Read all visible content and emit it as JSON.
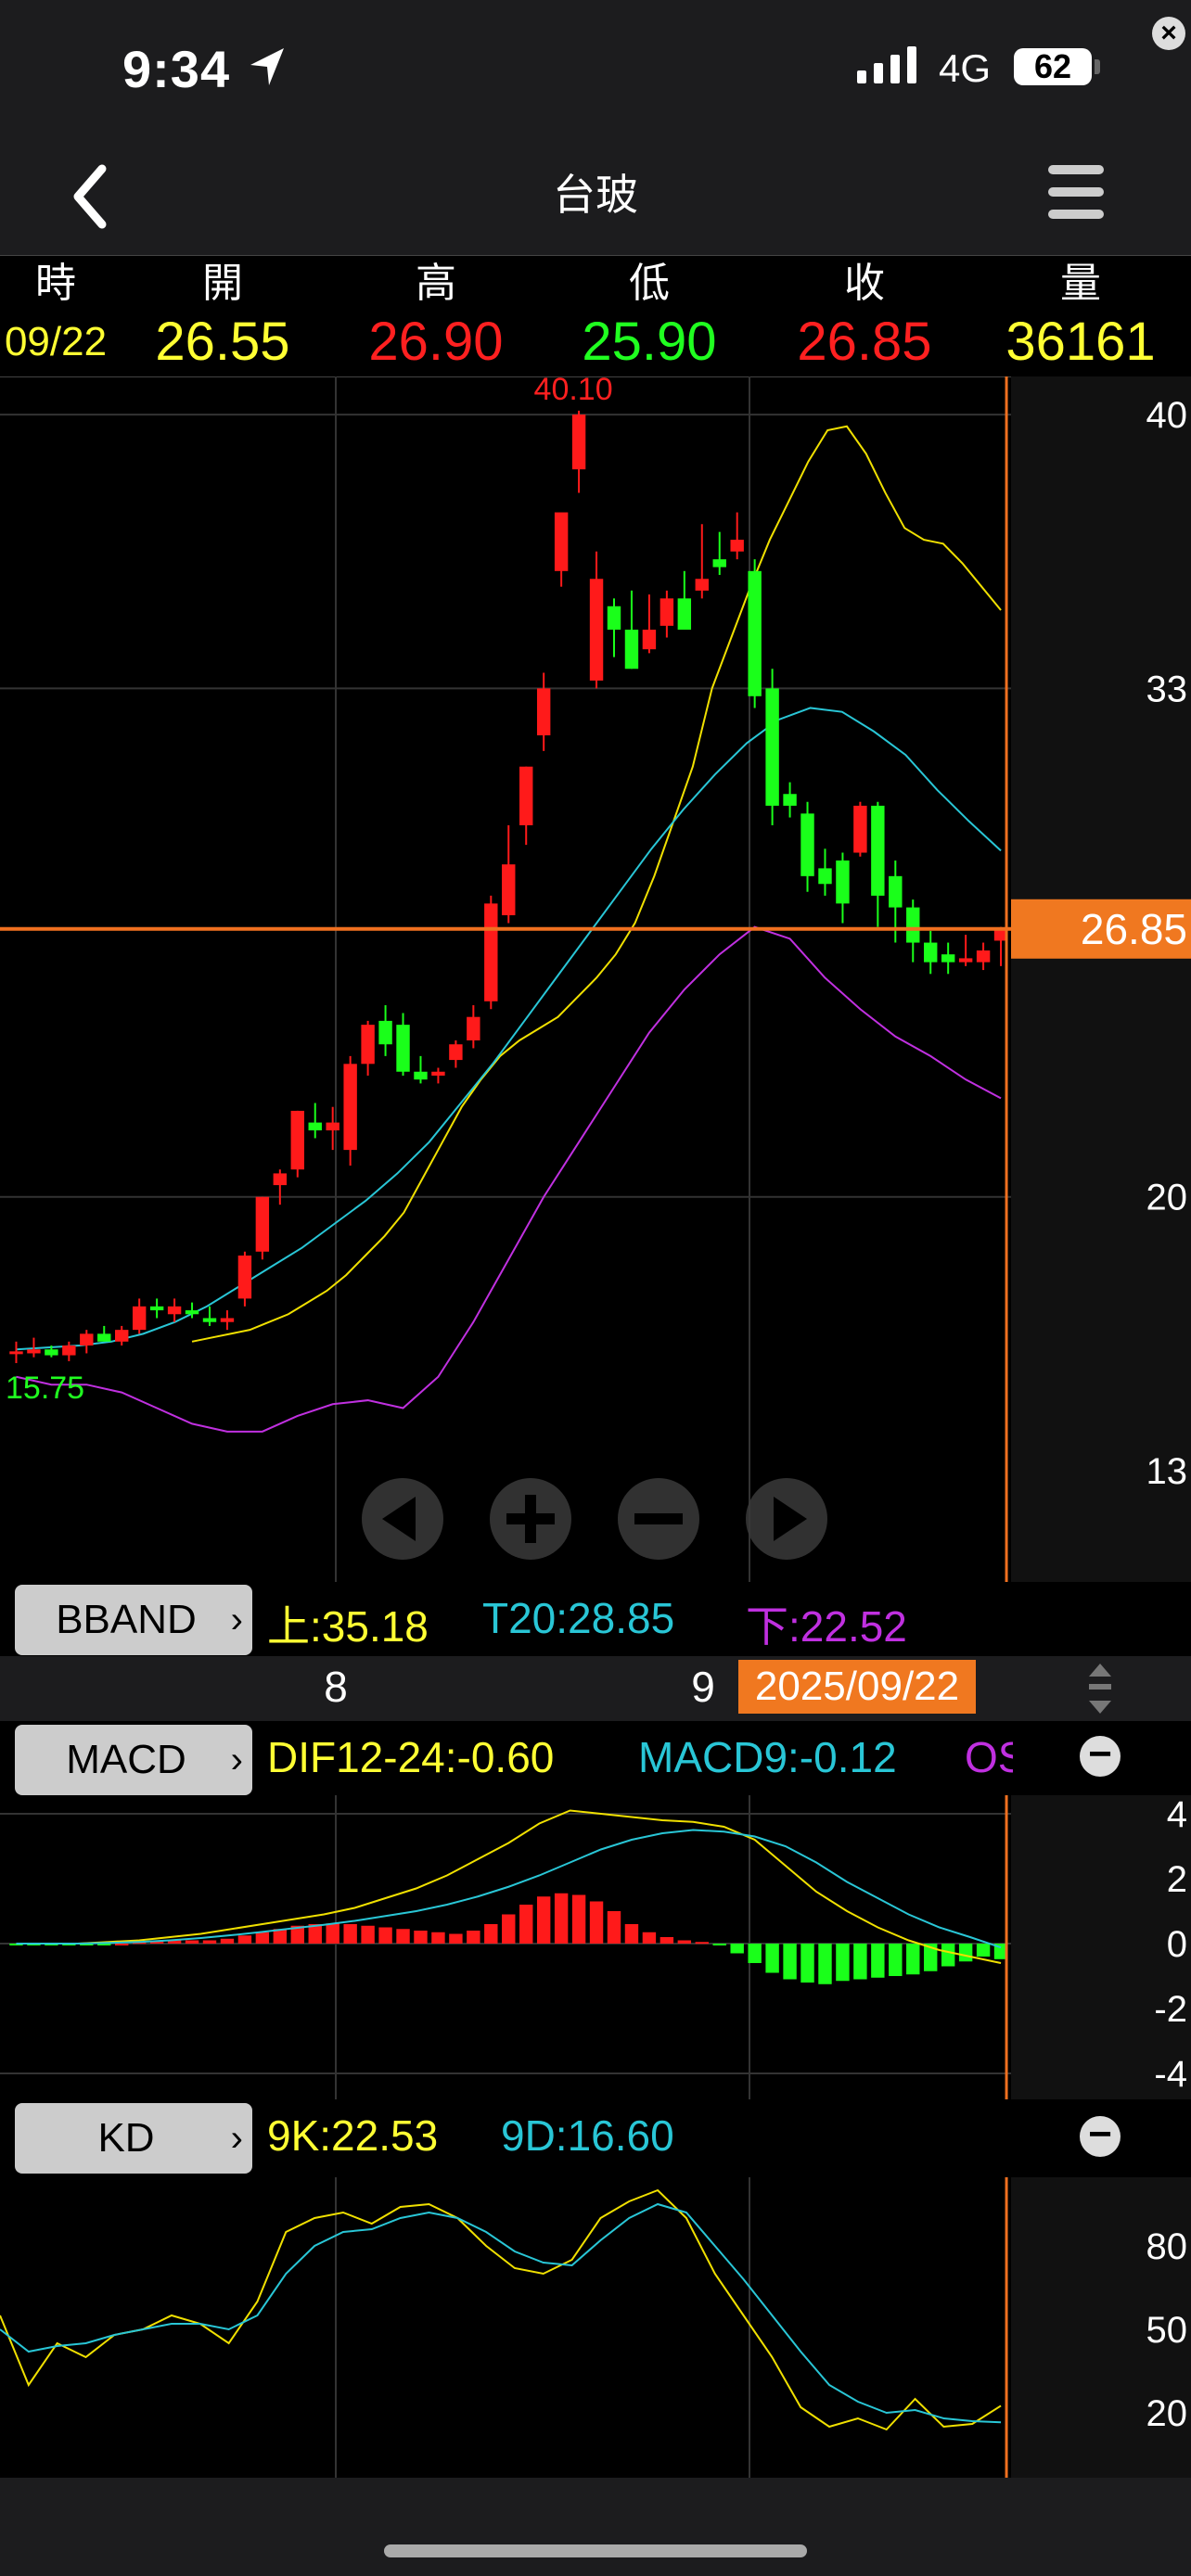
{
  "status_bar": {
    "time": "9:34",
    "network": "4G",
    "battery": "62"
  },
  "nav": {
    "title": "台玻"
  },
  "quote": {
    "headers": [
      "時",
      "開",
      "高",
      "低",
      "收",
      "量"
    ],
    "values": [
      "09/22",
      "26.55",
      "26.90",
      "25.90",
      "26.85",
      "36161"
    ],
    "colors": [
      "#ffff33",
      "#ffff33",
      "#ff2020",
      "#20ff20",
      "#ff2020",
      "#ffff33"
    ]
  },
  "main_chart": {
    "y_labels": [
      "40",
      "33",
      "20",
      "13"
    ],
    "high_label": "40.10",
    "low_label": "15.75",
    "current_price": "26.85",
    "legend": {
      "name": "BBAND",
      "upper": "上:35.18",
      "mid": "T20:28.85",
      "lower": "下:22.52"
    }
  },
  "date_axis": {
    "labels": [
      "8",
      "9"
    ],
    "selected": "2025/09/22"
  },
  "macd": {
    "name": "MACD",
    "dif": "DIF12-24:-0.60",
    "macd": "MACD9:-0.12",
    "osc": "OS",
    "y_labels": [
      "4",
      "2",
      "0",
      "-2",
      "-4"
    ]
  },
  "kd": {
    "name": "KD",
    "k": "9K:22.53",
    "d": "9D:16.60",
    "y_labels": [
      "80",
      "50",
      "20"
    ]
  },
  "colors": {
    "up": "#ff1a1a",
    "down": "#1aff1a",
    "upper_band": "#f0e000",
    "mid_band": "#29c6d6",
    "lower_band": "#c030e0",
    "cursor": "#f07020"
  },
  "chart_data": [
    {
      "type": "candlestick",
      "title": "台玻",
      "ylim": [
        13,
        40.5
      ],
      "candles_ohlc": [
        [
          16.0,
          16.3,
          15.75,
          16.05
        ],
        [
          16.0,
          16.4,
          15.9,
          16.1
        ],
        [
          16.1,
          16.2,
          15.9,
          15.95
        ],
        [
          15.95,
          16.3,
          15.8,
          16.2
        ],
        [
          16.2,
          16.6,
          16.0,
          16.5
        ],
        [
          16.5,
          16.7,
          16.3,
          16.3
        ],
        [
          16.3,
          16.7,
          16.2,
          16.6
        ],
        [
          16.6,
          17.4,
          16.5,
          17.2
        ],
        [
          17.2,
          17.4,
          16.9,
          17.1
        ],
        [
          17.0,
          17.4,
          16.8,
          17.2
        ],
        [
          17.1,
          17.3,
          16.9,
          17.0
        ],
        [
          16.9,
          17.2,
          16.7,
          16.8
        ],
        [
          16.8,
          17.1,
          16.6,
          16.9
        ],
        [
          17.4,
          18.6,
          17.2,
          18.5
        ],
        [
          18.6,
          20.0,
          18.4,
          20.0
        ],
        [
          20.3,
          20.7,
          19.8,
          20.6
        ],
        [
          20.7,
          22.2,
          20.5,
          22.2
        ],
        [
          21.9,
          22.4,
          21.5,
          21.7
        ],
        [
          21.7,
          22.3,
          21.2,
          21.9
        ],
        [
          21.2,
          23.6,
          20.8,
          23.4
        ],
        [
          23.4,
          24.5,
          23.1,
          24.4
        ],
        [
          24.5,
          24.9,
          23.6,
          23.9
        ],
        [
          24.4,
          24.7,
          23.1,
          23.2
        ],
        [
          23.2,
          23.6,
          22.9,
          23.0
        ],
        [
          23.1,
          23.3,
          22.9,
          23.2
        ],
        [
          23.5,
          24.0,
          23.3,
          23.9
        ],
        [
          24.0,
          24.9,
          23.8,
          24.6
        ],
        [
          25.0,
          27.7,
          24.8,
          27.5
        ],
        [
          27.2,
          29.5,
          27.0,
          28.5
        ],
        [
          29.5,
          31.0,
          29.0,
          31.0
        ],
        [
          31.8,
          33.4,
          31.4,
          33.0
        ],
        [
          36.0,
          37.0,
          35.6,
          37.5
        ],
        [
          38.6,
          40.1,
          38.0,
          40.0
        ],
        [
          33.2,
          36.5,
          33.0,
          35.8
        ],
        [
          35.1,
          35.3,
          33.8,
          34.5
        ],
        [
          34.5,
          35.5,
          33.5,
          33.5
        ],
        [
          34.0,
          35.4,
          33.9,
          34.5
        ],
        [
          34.6,
          35.5,
          34.3,
          35.3
        ],
        [
          35.3,
          36.0,
          34.8,
          34.5
        ],
        [
          35.5,
          37.2,
          35.3,
          35.8
        ],
        [
          36.3,
          37.0,
          35.9,
          36.1
        ],
        [
          36.5,
          37.5,
          36.3,
          36.8
        ],
        [
          36.0,
          36.3,
          32.5,
          32.8
        ],
        [
          33.0,
          33.5,
          29.5,
          30.0
        ],
        [
          30.3,
          30.6,
          29.7,
          30.0
        ],
        [
          29.8,
          30.1,
          27.8,
          28.2
        ],
        [
          28.4,
          28.9,
          27.7,
          28.0
        ],
        [
          28.6,
          28.8,
          27.0,
          27.5
        ],
        [
          28.8,
          30.1,
          28.7,
          30.0
        ],
        [
          30.0,
          30.1,
          26.9,
          27.7
        ],
        [
          28.2,
          28.6,
          26.5,
          27.4
        ],
        [
          27.4,
          27.6,
          26.0,
          26.5
        ],
        [
          26.5,
          26.8,
          25.7,
          26.0
        ],
        [
          26.2,
          26.5,
          25.7,
          26.0
        ],
        [
          26.0,
          26.7,
          25.9,
          26.1
        ],
        [
          26.0,
          26.5,
          25.8,
          26.3
        ],
        [
          26.55,
          26.9,
          25.9,
          26.85
        ]
      ],
      "upper_band": [
        16.3,
        16.4,
        16.5,
        16.6,
        16.8,
        17.0,
        17.3,
        17.6,
        18.0,
        18.5,
        19.0,
        19.6,
        20.5,
        21.4,
        22.3,
        23.0,
        23.6,
        24.0,
        24.3,
        24.6,
        25.1,
        25.6,
        26.2,
        27.0,
        28.2,
        29.6,
        31.0,
        33.0,
        34.3,
        35.6,
        36.8,
        37.8,
        38.8,
        39.6,
        39.7,
        39.0,
        38.0,
        37.1,
        36.8,
        36.7,
        36.2,
        35.6,
        35.0
      ],
      "mid_band": [
        16.1,
        16.15,
        16.2,
        16.3,
        16.5,
        16.8,
        17.2,
        17.7,
        18.2,
        18.7,
        19.3,
        19.9,
        20.6,
        21.4,
        22.4,
        23.4,
        24.5,
        25.6,
        26.7,
        27.8,
        28.9,
        29.9,
        30.8,
        31.6,
        32.2,
        32.5,
        32.4,
        31.9,
        31.3,
        30.4,
        29.6,
        28.85
      ],
      "lower_band": [
        15.4,
        15.2,
        15.2,
        15.0,
        14.6,
        14.2,
        14.0,
        14.0,
        14.4,
        14.7,
        14.8,
        14.6,
        15.4,
        16.8,
        18.4,
        20.0,
        21.4,
        22.8,
        24.2,
        25.3,
        26.2,
        26.9,
        26.6,
        25.6,
        24.8,
        24.1,
        23.6,
        23.0,
        22.52
      ]
    },
    {
      "type": "bar",
      "title": "MACD",
      "ylim": [
        -4,
        4
      ],
      "osc": [
        -0.05,
        -0.05,
        -0.05,
        -0.04,
        -0.03,
        -0.02,
        0.0,
        0.05,
        0.08,
        0.1,
        0.1,
        0.1,
        0.15,
        0.25,
        0.35,
        0.45,
        0.55,
        0.6,
        0.62,
        0.6,
        0.55,
        0.5,
        0.45,
        0.4,
        0.35,
        0.3,
        0.4,
        0.6,
        0.9,
        1.2,
        1.45,
        1.55,
        1.5,
        1.3,
        1.0,
        0.6,
        0.35,
        0.2,
        0.1,
        0.05,
        -0.05,
        -0.3,
        -0.6,
        -0.9,
        -1.1,
        -1.2,
        -1.25,
        -1.15,
        -1.1,
        -1.05,
        -1.0,
        -0.95,
        -0.85,
        -0.7,
        -0.55,
        -0.4,
        -0.48
      ],
      "dif": [
        0.0,
        0.0,
        0.0,
        0.05,
        0.1,
        0.2,
        0.3,
        0.45,
        0.6,
        0.75,
        0.9,
        1.1,
        1.4,
        1.7,
        2.1,
        2.6,
        3.1,
        3.7,
        4.1,
        4.0,
        3.9,
        3.8,
        3.75,
        3.6,
        3.2,
        2.4,
        1.6,
        1.0,
        0.5,
        0.1,
        -0.2,
        -0.4,
        -0.6
      ],
      "macd9": [
        0.0,
        0.0,
        0.0,
        0.02,
        0.05,
        0.1,
        0.17,
        0.26,
        0.36,
        0.47,
        0.58,
        0.7,
        0.85,
        1.0,
        1.2,
        1.45,
        1.75,
        2.1,
        2.5,
        2.9,
        3.2,
        3.4,
        3.5,
        3.45,
        3.3,
        3.0,
        2.5,
        1.9,
        1.4,
        0.9,
        0.5,
        0.2,
        -0.12
      ]
    },
    {
      "type": "line",
      "title": "KD",
      "ylim": [
        0,
        100
      ],
      "k": [
        55,
        30,
        45,
        40,
        48,
        50,
        55,
        52,
        45,
        60,
        85,
        90,
        92,
        88,
        94,
        95,
        90,
        80,
        72,
        70,
        75,
        90,
        96,
        100,
        90,
        70,
        55,
        40,
        22,
        15,
        18,
        14,
        25,
        15,
        16,
        22.53
      ],
      "d": [
        50,
        42,
        44,
        45,
        48,
        50,
        52,
        52,
        50,
        55,
        70,
        80,
        85,
        86,
        90,
        92,
        90,
        85,
        78,
        74,
        73,
        82,
        90,
        95,
        92,
        80,
        68,
        55,
        42,
        30,
        24,
        20,
        21,
        18,
        17,
        16.6
      ]
    }
  ]
}
